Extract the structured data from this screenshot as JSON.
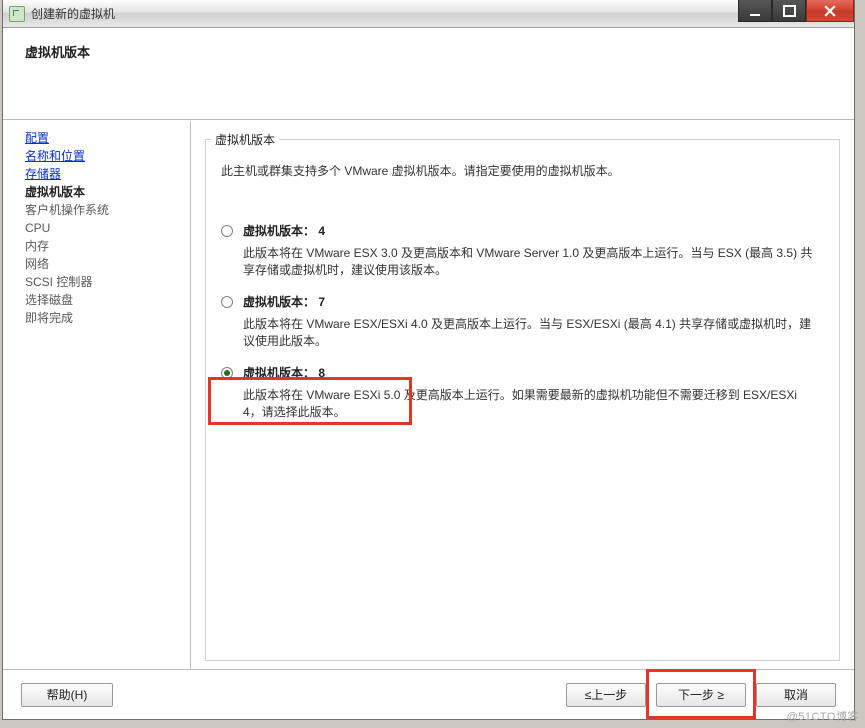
{
  "window": {
    "title": "创建新的虚拟机"
  },
  "header": {
    "title": "虚拟机版本"
  },
  "sidebar": {
    "items": [
      {
        "label": "配置",
        "kind": "link"
      },
      {
        "label": "名称和位置",
        "kind": "link"
      },
      {
        "label": "存储器",
        "kind": "link"
      },
      {
        "label": "虚拟机版本",
        "kind": "bold"
      },
      {
        "label": "客户机操作系统",
        "kind": "disabled"
      },
      {
        "label": "CPU",
        "kind": "disabled"
      },
      {
        "label": "内存",
        "kind": "disabled"
      },
      {
        "label": "网络",
        "kind": "disabled"
      },
      {
        "label": "SCSI 控制器",
        "kind": "disabled"
      },
      {
        "label": "选择磁盘",
        "kind": "disabled"
      },
      {
        "label": "即将完成",
        "kind": "disabled"
      }
    ]
  },
  "content": {
    "legend": "虚拟机版本",
    "intro": "此主机或群集支持多个 VMware 虚拟机版本。请指定要使用的虚拟机版本。",
    "options": [
      {
        "label": "虚拟机版本： 4",
        "desc": "此版本将在 VMware ESX 3.0 及更高版本和 VMware Server 1.0 及更高版本上运行。当与 ESX (最高 3.5) 共享存储或虚拟机时，建议使用该版本。",
        "selected": false
      },
      {
        "label": "虚拟机版本： 7",
        "desc": "此版本将在 VMware ESX/ESXi 4.0 及更高版本上运行。当与 ESX/ESXi (最高 4.1) 共享存储或虚拟机时，建议使用此版本。",
        "selected": false
      },
      {
        "label": "虚拟机版本： 8",
        "desc": "此版本将在 VMware ESXi 5.0 及更高版本上运行。如果需要最新的虚拟机功能但不需要迁移到 ESX/ESXi 4，请选择此版本。",
        "selected": true
      }
    ]
  },
  "footer": {
    "help": "帮助(H)",
    "back": "≤上一步",
    "next": "下一步 ≥",
    "cancel": "取消"
  },
  "watermark": "@51CTO博客"
}
